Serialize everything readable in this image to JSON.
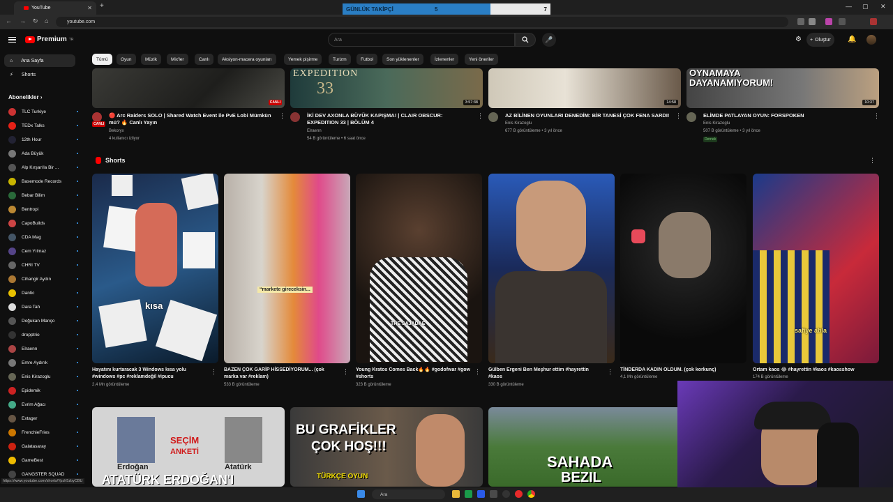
{
  "browser": {
    "tab_title": "YouTube",
    "url": "youtube.com",
    "status_url": "https://www.youtube.com/shorts/Ypzh5zbyCBU"
  },
  "overlay": {
    "label": "GÜNLÜK TAKİPÇİ",
    "value_left": "5",
    "value_right": "7"
  },
  "header": {
    "logo_text": "Premium",
    "logo_sup": "TR",
    "search_placeholder": "Ara",
    "create_label": "Oluştur"
  },
  "sidebar": {
    "main": [
      {
        "label": "Ana Sayfa"
      },
      {
        "label": "Shorts"
      }
    ],
    "subs_heading": "Abonelikler",
    "subs": [
      {
        "label": "TLC Turkiye",
        "color": "#c33"
      },
      {
        "label": "TEDx Talks",
        "color": "#e62117"
      },
      {
        "label": "12th Hour",
        "color": "#223"
      },
      {
        "label": "Ada Büyük",
        "color": "#777"
      },
      {
        "label": "Alp Kırşan'la Bir ...",
        "color": "#555"
      },
      {
        "label": "Basemode Records",
        "color": "#c8b400"
      },
      {
        "label": "Bebar Bilim",
        "color": "#2a6a3a"
      },
      {
        "label": "Bentropi",
        "color": "#b83"
      },
      {
        "label": "CapoBuilds",
        "color": "#c44"
      },
      {
        "label": "CDA Mag",
        "color": "#456"
      },
      {
        "label": "Cem Yılmaz",
        "color": "#548"
      },
      {
        "label": "CHRI TV",
        "color": "#666"
      },
      {
        "label": "Cihangir Aydın",
        "color": "#a73"
      },
      {
        "label": "Dantic",
        "color": "#e8c000"
      },
      {
        "label": "Dara Tah",
        "color": "#ddd"
      },
      {
        "label": "Doğukan Mançо",
        "color": "#555"
      },
      {
        "label": "dropptrio",
        "color": "#333"
      },
      {
        "label": "Elraenn",
        "color": "#a44"
      },
      {
        "label": "Emre Aydırık",
        "color": "#777"
      },
      {
        "label": "Enis Kirazoglu",
        "color": "#665"
      },
      {
        "label": "Epidemik",
        "color": "#c22"
      },
      {
        "label": "Evrim Ağacı",
        "color": "#4a8"
      },
      {
        "label": "Extager",
        "color": "#654"
      },
      {
        "label": "FrenchieFries",
        "color": "#c70"
      },
      {
        "label": "Galatasaray",
        "color": "#c21"
      },
      {
        "label": "GameBest",
        "color": "#eb0"
      },
      {
        "label": "GANGSTER SQUAD",
        "color": "#444"
      }
    ]
  },
  "chips": [
    "Tümü",
    "Oyun",
    "Müzik",
    "Mix'ler",
    "Canlı",
    "Aksiyon-macera oyunları",
    "Yemek pişirme",
    "Turizm",
    "Futbol",
    "Son yüklenenler",
    "İzlenenler",
    "Yeni öneriler"
  ],
  "videos": [
    {
      "title": "🔴 Arc Raiders SOLO | Shared Watch Event ile PvE Lobi Mümkün mü? 🔥 Canlı Yayın",
      "channel": "Bekoryx",
      "meta": "4 kullanıcı izliyor",
      "badge": "CANLI",
      "avatar_badge": "CANLI"
    },
    {
      "title": "İKİ DEV AXONLA BÜYÜK KAPIŞMA! | CLAIR OBSCUR: EXPEDITION 33 | BÖLÜM 4",
      "channel": "Elraenn",
      "meta": "54 B görüntüleme • 6 saat önce",
      "badge": "3:57:38",
      "thumb_text": "EXPEDITION",
      "thumb_num": "33"
    },
    {
      "title": "AZ BİLİNEN OYUNLARI DENEDİM: BİR TANESİ ÇOK FENA SARDI!",
      "channel": "Enis Kirazoglu",
      "meta": "677 B görüntüleme • 3 yıl önce",
      "badge": "14:58"
    },
    {
      "title": "ELİMDE PATLAYAN OYUN: FORSPOKEN",
      "channel": "Enis Kirazoglu",
      "meta": "507 B görüntüleme • 3 yıl önce",
      "badge": "10:37",
      "new": "Dernek",
      "thumb_text": "OYNAMAYA DAYANAMIYORUM!"
    }
  ],
  "shorts_heading": "Shorts",
  "shorts": [
    {
      "title": "Hayatını kurtaracak 3 Windows kısa yolu #windows #pc #reklamdeğil #ipucu",
      "views": "2,4 Mn görüntüleme",
      "caption": "kısa"
    },
    {
      "title": "BAZEN ÇOK GARİP HİSSEDİYORUM... (çok marka var #reklam)",
      "views": "533 B görüntüleme",
      "caption": "“markete gireceksin..."
    },
    {
      "title": "Young Kratos Comes Back🔥🔥 #godofwar #gow #shorts",
      "views": "323 B görüntüleme",
      "caption": "THE SAJADAE"
    },
    {
      "title": "Gülben Ergeni Ben Meşhur ettim #hayrettin #kaos",
      "views": "330 B görüntüleme",
      "caption": ""
    },
    {
      "title": "TİNDERDA KADIN OLDUM. (çok korkunç)",
      "views": "4,1 Mn görüntüleme",
      "caption": ""
    },
    {
      "title": "Ortam kaos 😂 #hayrettin #kaos #kaosshow",
      "views": "174 B görüntüleme",
      "caption": "safiye abla"
    }
  ],
  "row3": [
    {
      "text1": "SEÇİM",
      "text2": "ANKETİ",
      "name1": "Erdoğan",
      "name2": "Atatürk",
      "big": "ATATÜRK ERDOĞAN'I"
    },
    {
      "text1": "BU GRAFİKLER",
      "text2": "ÇOK HOŞ!!!",
      "sub": "TÜRKÇE OYUN"
    },
    {
      "text1": "SAHADA",
      "text2": "BEZIL"
    }
  ],
  "taskbar": {
    "search_placeholder": "Ara"
  }
}
